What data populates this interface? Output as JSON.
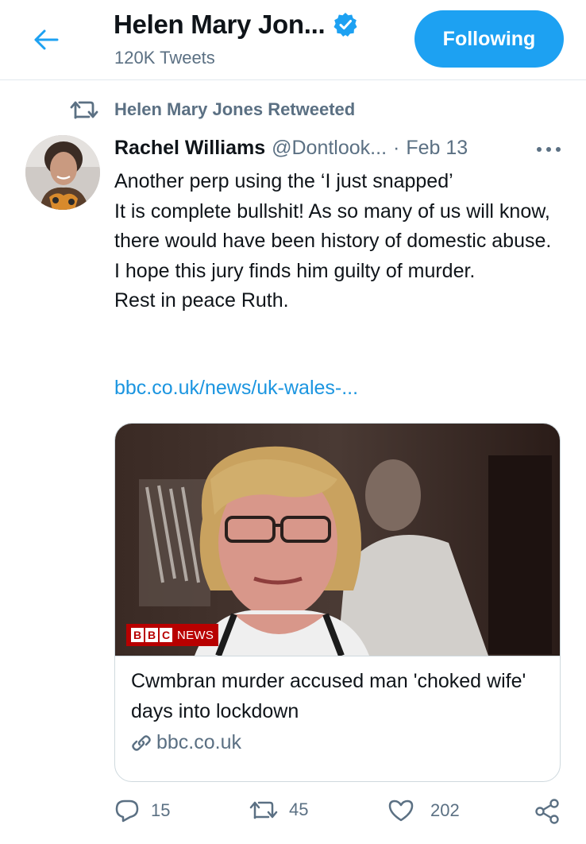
{
  "header": {
    "back_icon": "arrow-left-icon",
    "title": "Helen Mary Jon...",
    "verified_icon": "verified-badge-icon",
    "tweet_count": "120K Tweets",
    "follow_button": "Following"
  },
  "retweet_notice": {
    "icon": "retweet-icon",
    "text": "Helen Mary Jones Retweeted"
  },
  "tweet": {
    "author_name": "Rachel Williams",
    "author_handle": "@Dontlook...",
    "separator": "·",
    "date": "Feb 13",
    "more_icon": "more-horizontal-icon",
    "text_lines": [
      "Another perp using the ‘I just snapped’",
      "It is complete bullshit! As so many of us will know, there would have been history of domestic abuse.",
      "I hope this jury finds him guilty of murder.",
      "Rest in peace Ruth."
    ],
    "link": "bbc.co.uk/news/uk-wales-..."
  },
  "card": {
    "badge_letters": [
      "B",
      "B",
      "C"
    ],
    "badge_text": "NEWS",
    "title": "Cwmbran murder accused man 'choked wife' days into lockdown",
    "domain_icon": "link-icon",
    "domain": "bbc.co.uk"
  },
  "actions": {
    "reply": {
      "icon": "reply-icon",
      "count": "15"
    },
    "retweet": {
      "icon": "retweet-icon",
      "count": "45"
    },
    "like": {
      "icon": "heart-icon",
      "count": "202"
    },
    "share": {
      "icon": "share-icon"
    }
  },
  "colors": {
    "accent": "#1da1f2",
    "link": "#1b95e0",
    "secondary_text": "#5b7083",
    "bbc_red": "#b80000"
  }
}
